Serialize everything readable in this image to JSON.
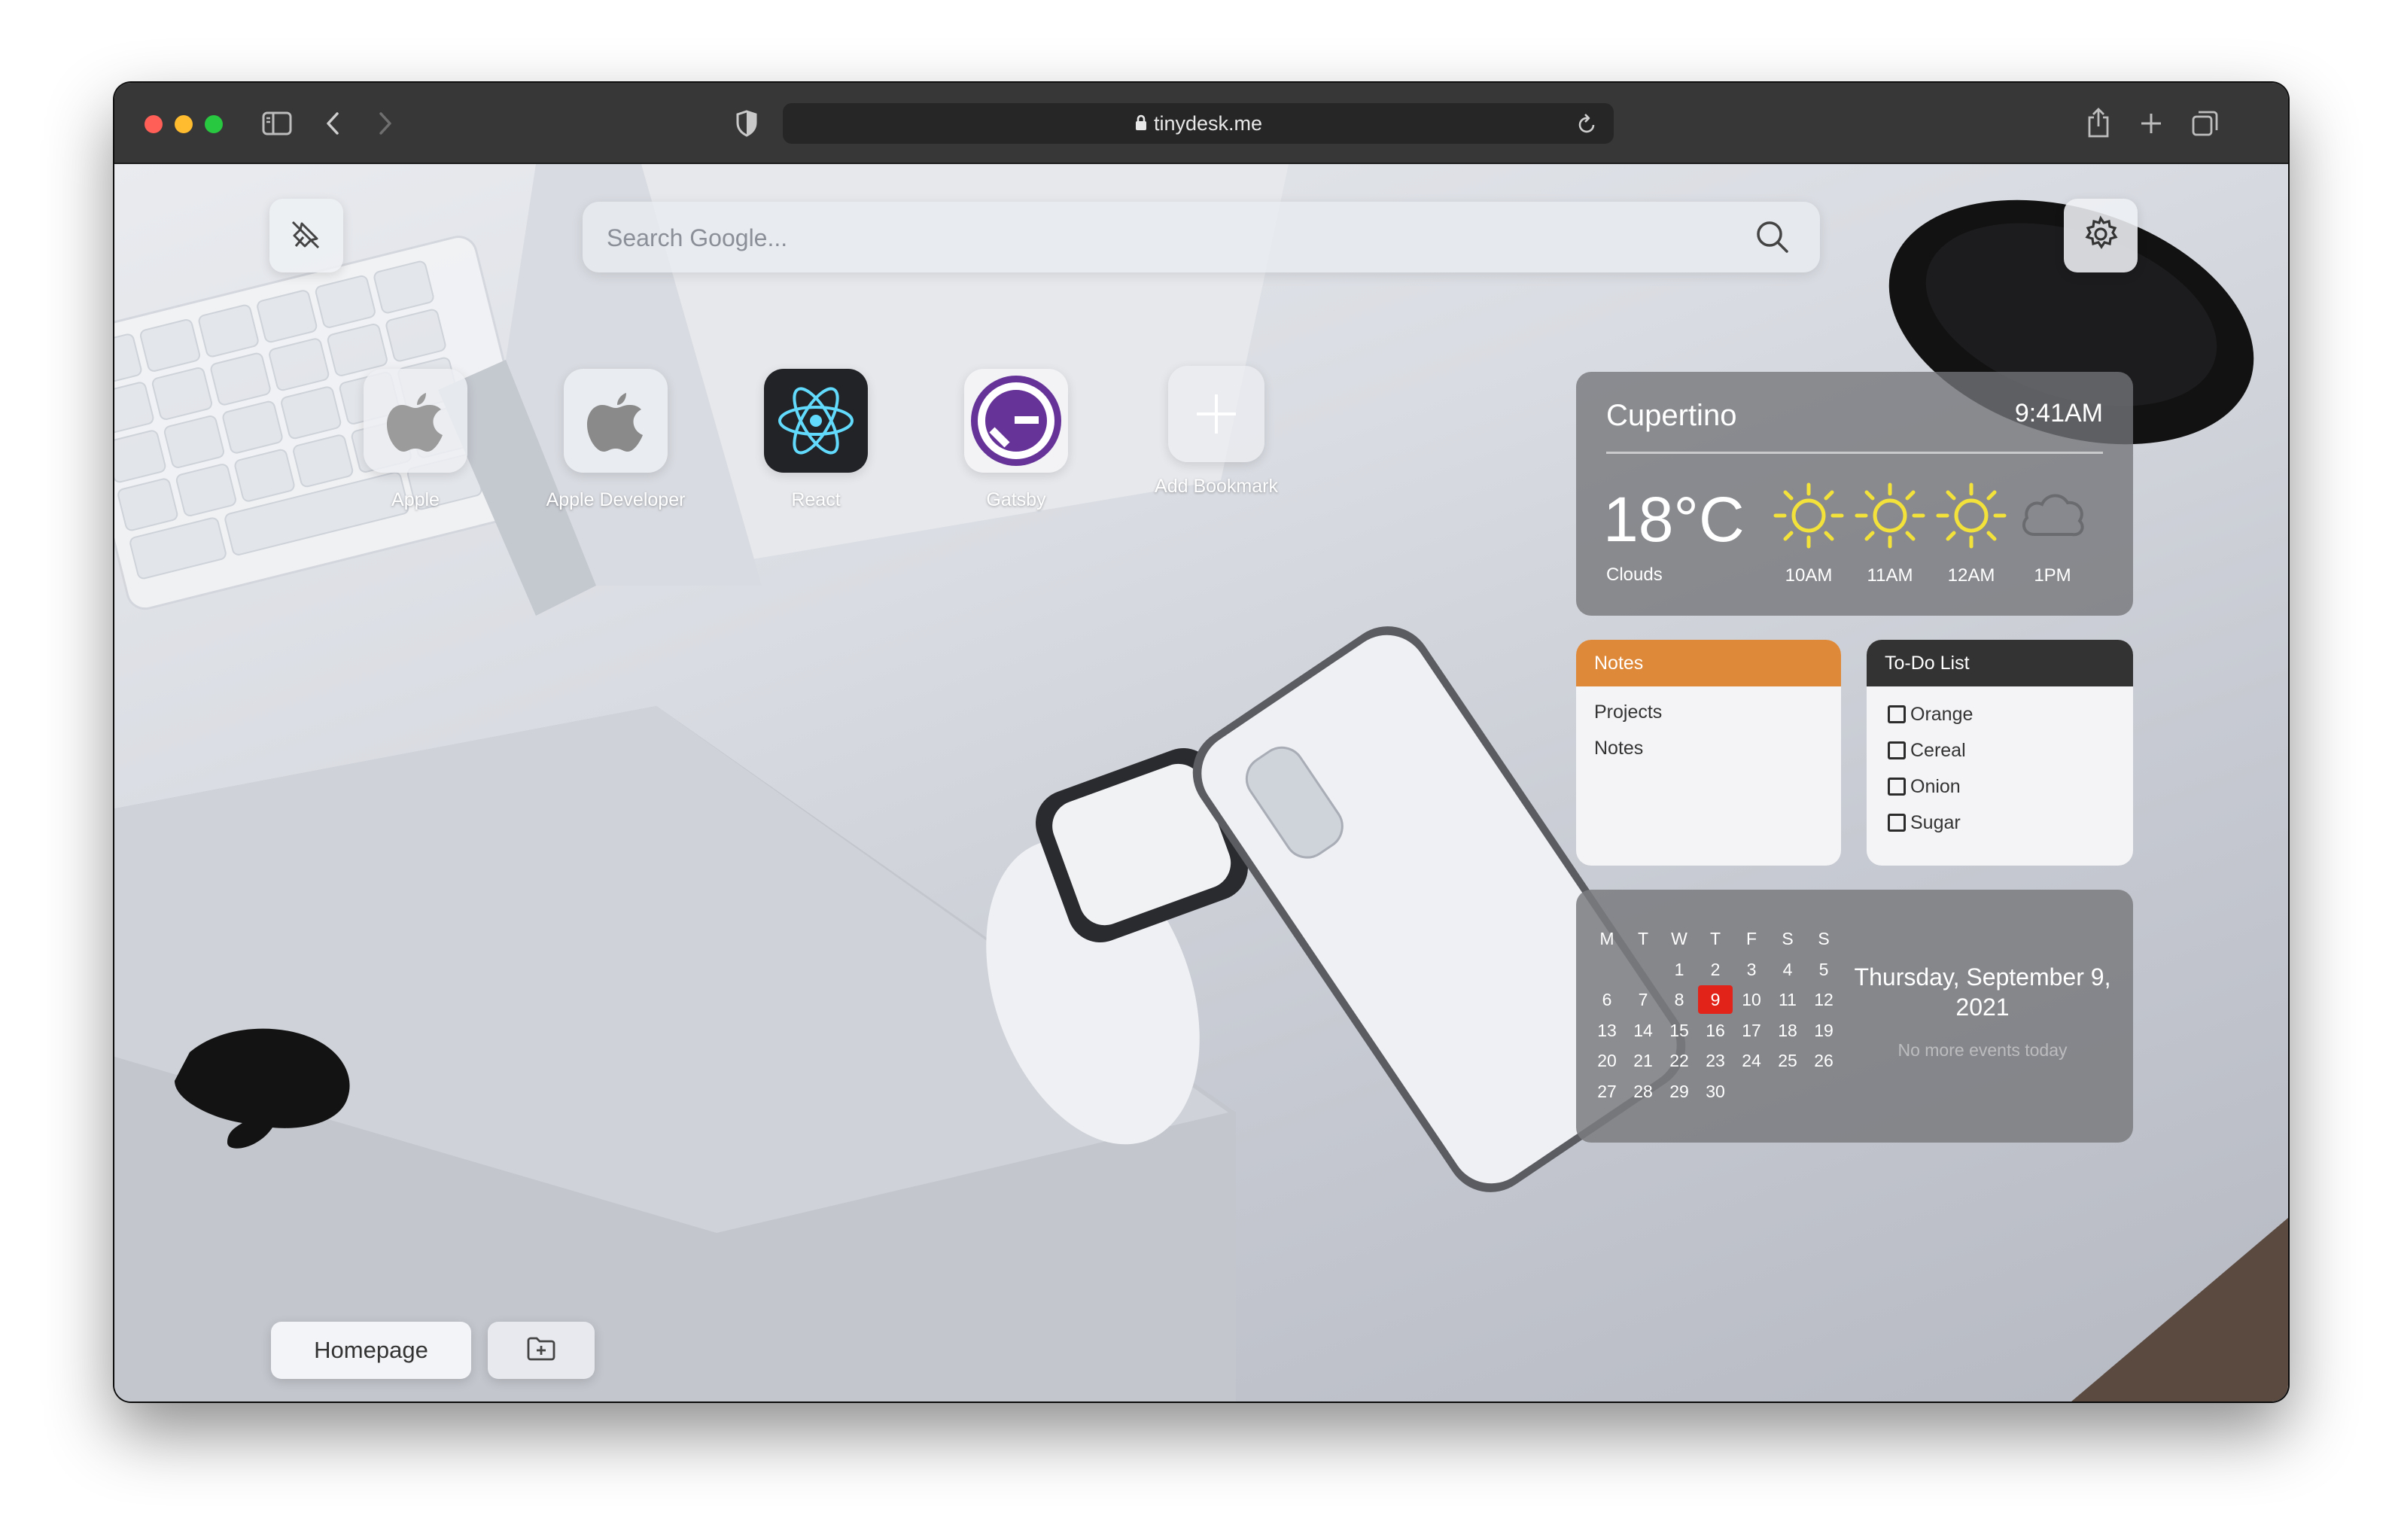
{
  "browser": {
    "url": "tinydesk.me",
    "icons": {
      "sidebar": "sidebar-icon",
      "back": "chevron-left-icon",
      "forward": "chevron-right-icon",
      "privacy": "shield-icon",
      "lock": "lock-icon",
      "reload": "reload-icon",
      "share": "share-icon",
      "new_tab": "plus-icon",
      "tabs": "tabs-overview-icon"
    }
  },
  "search": {
    "placeholder": "Search Google..."
  },
  "bookmarks": [
    {
      "label": "Apple",
      "icon": "apple-icon"
    },
    {
      "label": "Apple Developer",
      "icon": "apple-icon"
    },
    {
      "label": "React",
      "icon": "react-icon"
    },
    {
      "label": "Gatsby",
      "icon": "gatsby-icon"
    },
    {
      "label": "Add Bookmark",
      "icon": "plus-icon"
    }
  ],
  "weather": {
    "city": "Cupertino",
    "time": "9:41AM",
    "temperature": "18°C",
    "condition": "Clouds",
    "forecast": [
      {
        "hour": "10AM",
        "icon": "sun-icon"
      },
      {
        "hour": "11AM",
        "icon": "sun-icon"
      },
      {
        "hour": "12AM",
        "icon": "sun-icon"
      },
      {
        "hour": "1PM",
        "icon": "cloud-icon"
      }
    ]
  },
  "notes": {
    "title": "Notes",
    "items": [
      "Projects",
      "Notes"
    ]
  },
  "todo": {
    "title": "To-Do List",
    "items": [
      {
        "label": "Orange",
        "checked": false
      },
      {
        "label": "Cereal",
        "checked": false
      },
      {
        "label": "Onion",
        "checked": false
      },
      {
        "label": "Sugar",
        "checked": false
      }
    ]
  },
  "calendar": {
    "weekdays": [
      "M",
      "T",
      "W",
      "T",
      "F",
      "S",
      "S"
    ],
    "weeks": [
      [
        "",
        "",
        "1",
        "2",
        "3",
        "4",
        "5"
      ],
      [
        "6",
        "7",
        "8",
        "9",
        "10",
        "11",
        "12"
      ],
      [
        "13",
        "14",
        "15",
        "16",
        "17",
        "18",
        "19"
      ],
      [
        "20",
        "21",
        "22",
        "23",
        "24",
        "25",
        "26"
      ],
      [
        "27",
        "28",
        "29",
        "30",
        "",
        "",
        ""
      ]
    ],
    "today": "9",
    "today_color": "#e2231a",
    "date_label": "Thursday, September 9, 2021",
    "no_events": "No more events today"
  },
  "footer": {
    "homepage_label": "Homepage",
    "new_folder_icon": "folder-plus-icon"
  },
  "colors": {
    "notes_header": "#de8839",
    "todo_header": "#333333",
    "sun": "#f3e23a"
  }
}
